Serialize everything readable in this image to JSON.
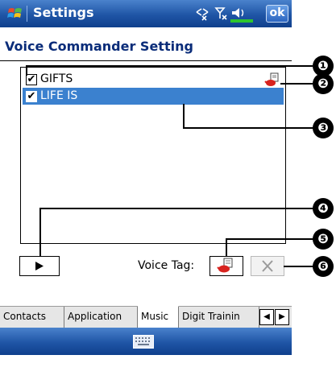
{
  "titlebar": {
    "app_title": "Settings",
    "ok_label": "ok"
  },
  "page": {
    "title": "Voice Commander Setting"
  },
  "list": {
    "items": [
      {
        "label": "GIFTS",
        "checked": true,
        "check_mark": "✔",
        "has_voice_tag": true,
        "selected": false
      },
      {
        "label": "LIFE IS",
        "checked": true,
        "check_mark": "✔",
        "has_voice_tag": false,
        "selected": true
      }
    ]
  },
  "controls": {
    "play_icon": "play-icon",
    "voice_tag_label": "Voice Tag:",
    "record_icon": "voice-tag-icon",
    "delete_icon": "delete-icon"
  },
  "tabs": {
    "items": [
      "Contacts",
      "Application",
      "Music",
      "Digit Trainin"
    ],
    "active_index": 2,
    "left_arrow": "◀",
    "right_arrow": "▶"
  },
  "callouts": [
    "❶",
    "❷",
    "❸",
    "❹",
    "❺",
    "❻"
  ],
  "colors": {
    "title_bar": "#1f55a6",
    "selection": "#3b81cf",
    "page_title": "#0a2c79",
    "callout": "#000000"
  }
}
